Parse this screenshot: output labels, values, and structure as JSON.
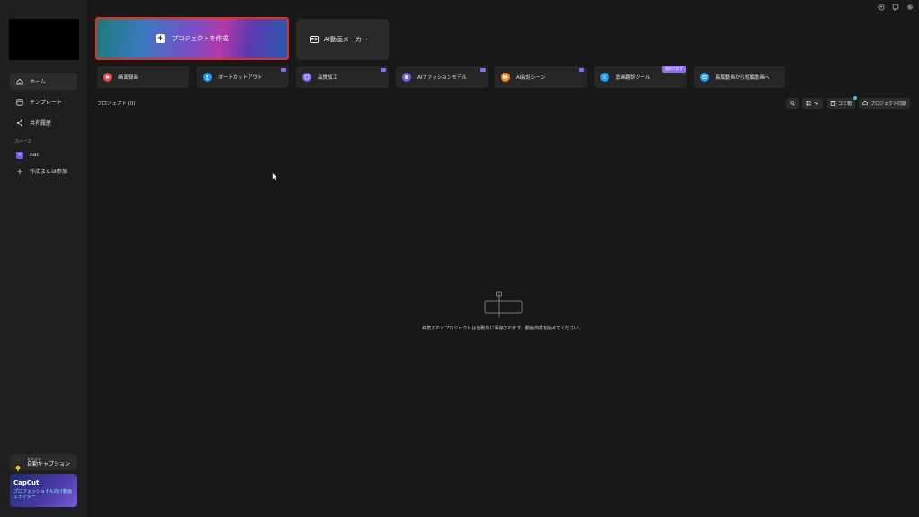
{
  "sidebar": {
    "nav": [
      {
        "label": "ホーム",
        "icon": "home-icon",
        "active": true
      },
      {
        "label": "テンプレート",
        "icon": "template-icon",
        "active": false
      },
      {
        "label": "共有履歴",
        "icon": "share-icon",
        "active": false
      }
    ],
    "space_label": "スペース",
    "space_user": {
      "avatar": "n",
      "name": "nao"
    },
    "create_join_label": "作成または参加",
    "promo_caption": {
      "tag": "おすすめ",
      "title": "自動キャプション"
    },
    "promo_banner": {
      "brand": "CapCut",
      "desc": "プロフェッショナル向け動画エディター"
    }
  },
  "main": {
    "create_project_label": "プロジェクトを作成",
    "ai_maker_label": "AI動画メーカー",
    "tools": [
      {
        "label": "画面録画",
        "icon": "record-icon",
        "color": "#e8454f"
      },
      {
        "label": "オートカットアウト",
        "icon": "cutout-icon",
        "color": "#1e9cf0"
      },
      {
        "label": "品質加工",
        "icon": "quality-icon",
        "color": "#7a5cf0"
      },
      {
        "label": "AIファッションモデル",
        "icon": "fashion-icon",
        "color": "#7a5cf0"
      },
      {
        "label": "AI会話シーン",
        "icon": "chat-scene-icon",
        "color": "#f08a1e"
      },
      {
        "label": "動画翻訳ツール",
        "icon": "translate-icon",
        "color": "#1e9cf0",
        "badge": "無料で試す"
      },
      {
        "label": "長編動画から短編動画へ",
        "icon": "long-to-short-icon",
        "color": "#1e9cf0"
      }
    ],
    "projects_title": "プロジェクト (0)",
    "trash_label": "ゴミ箱",
    "cloud_label": "プロジェクト同期",
    "empty_message": "編集されたプロジェクトは自動的に保存されます。動画作成を始めてください。"
  },
  "colors": {
    "background": "#181818",
    "sidebar": "#1f1f1f",
    "highlight_border": "#e0321e",
    "accent_purple": "#8a6cf0"
  }
}
